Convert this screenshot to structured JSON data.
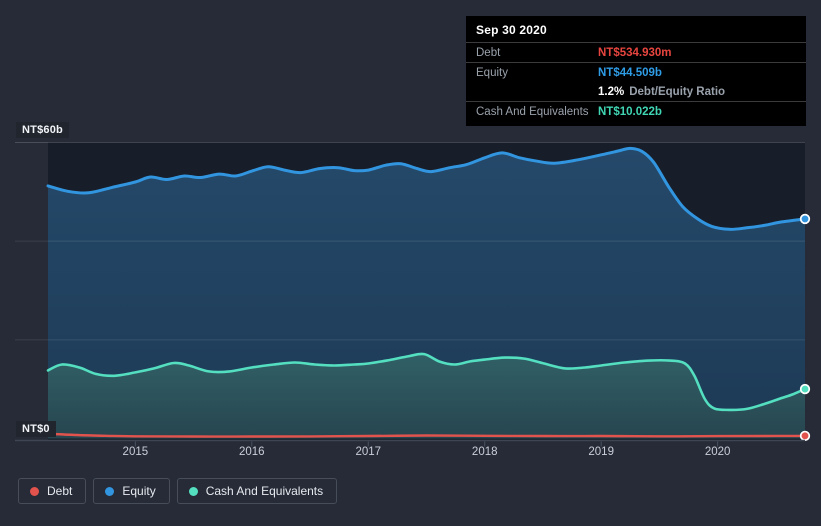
{
  "page": {
    "bg": "#262b37",
    "plot_bg": "#171e29"
  },
  "tooltip": {
    "date": "Sep 30 2020",
    "rows": [
      {
        "label": "Debt",
        "value": "NT$534.930m"
      },
      {
        "label": "Equity",
        "value": "NT$44.509b"
      },
      {
        "label": "",
        "value_bold": "1.2%",
        "value_rest": "Debt/Equity Ratio"
      },
      {
        "label": "Cash And Equivalents",
        "value": "NT$10.022b"
      }
    ]
  },
  "axis": {
    "y_top_label": "NT$60b",
    "y_zero_label": "NT$0",
    "years": [
      "2015",
      "2016",
      "2017",
      "2018",
      "2019",
      "2020"
    ]
  },
  "legend": [
    {
      "label": "Debt"
    },
    {
      "label": "Equity"
    },
    {
      "label": "Cash And Equivalents"
    }
  ],
  "colors": {
    "debt_line": "#e2534d",
    "equity_line": "#3295e0",
    "cash_line": "#54dfc0",
    "debt_text": "#e8453f",
    "equity_text": "#2f9ce6",
    "cash_text": "#40d6b4",
    "equity_fill_top": "#25496a",
    "equity_fill_bottom": "#1d3a55",
    "cash_fill_top": "#316067",
    "cash_fill_bottom": "#27454f",
    "grid": "rgba(255,255,255,0.10)",
    "grid_top": "rgba(255,255,255,0.17)",
    "axis_line": "#3f4552",
    "tick": "#4a5160"
  },
  "chart_data": {
    "type": "area",
    "title": "",
    "unit": "NT$ billions",
    "x_domain": [
      2014.25,
      2020.75
    ],
    "y_domain": [
      0,
      60
    ],
    "y_gridlines_b": [
      20,
      40,
      60
    ],
    "x_ticks": [
      2015,
      2016,
      2017,
      2018,
      2019,
      2020
    ],
    "series": [
      {
        "name": "Equity",
        "points": [
          [
            2014.25,
            51.2
          ],
          [
            2014.42,
            50.1
          ],
          [
            2014.6,
            49.8
          ],
          [
            2014.8,
            50.9
          ],
          [
            2015.0,
            52.0
          ],
          [
            2015.13,
            53.0
          ],
          [
            2015.27,
            52.5
          ],
          [
            2015.42,
            53.2
          ],
          [
            2015.56,
            52.9
          ],
          [
            2015.72,
            53.6
          ],
          [
            2015.86,
            53.2
          ],
          [
            2016.0,
            54.2
          ],
          [
            2016.14,
            55.1
          ],
          [
            2016.28,
            54.4
          ],
          [
            2016.42,
            53.9
          ],
          [
            2016.58,
            54.7
          ],
          [
            2016.74,
            54.9
          ],
          [
            2016.88,
            54.3
          ],
          [
            2017.0,
            54.4
          ],
          [
            2017.15,
            55.4
          ],
          [
            2017.28,
            55.7
          ],
          [
            2017.42,
            54.7
          ],
          [
            2017.54,
            54.1
          ],
          [
            2017.7,
            54.9
          ],
          [
            2017.84,
            55.5
          ],
          [
            2018.0,
            56.9
          ],
          [
            2018.15,
            57.9
          ],
          [
            2018.3,
            56.9
          ],
          [
            2018.45,
            56.2
          ],
          [
            2018.6,
            55.8
          ],
          [
            2018.8,
            56.5
          ],
          [
            2019.0,
            57.5
          ],
          [
            2019.15,
            58.3
          ],
          [
            2019.25,
            58.8
          ],
          [
            2019.35,
            58.2
          ],
          [
            2019.45,
            56.0
          ],
          [
            2019.58,
            51.0
          ],
          [
            2019.7,
            47.0
          ],
          [
            2019.83,
            44.5
          ],
          [
            2019.95,
            43.0
          ],
          [
            2020.1,
            42.4
          ],
          [
            2020.25,
            42.7
          ],
          [
            2020.4,
            43.2
          ],
          [
            2020.55,
            43.9
          ],
          [
            2020.75,
            44.509
          ]
        ]
      },
      {
        "name": "Cash And Equivalents",
        "points": [
          [
            2014.25,
            13.8
          ],
          [
            2014.37,
            15.0
          ],
          [
            2014.52,
            14.4
          ],
          [
            2014.66,
            13.1
          ],
          [
            2014.82,
            12.7
          ],
          [
            2015.0,
            13.4
          ],
          [
            2015.16,
            14.2
          ],
          [
            2015.33,
            15.3
          ],
          [
            2015.46,
            14.8
          ],
          [
            2015.63,
            13.6
          ],
          [
            2015.81,
            13.6
          ],
          [
            2016.0,
            14.4
          ],
          [
            2016.19,
            15.0
          ],
          [
            2016.37,
            15.4
          ],
          [
            2016.54,
            15.0
          ],
          [
            2016.71,
            14.8
          ],
          [
            2016.88,
            15.0
          ],
          [
            2017.0,
            15.2
          ],
          [
            2017.18,
            15.9
          ],
          [
            2017.35,
            16.7
          ],
          [
            2017.48,
            17.1
          ],
          [
            2017.61,
            15.6
          ],
          [
            2017.74,
            15.0
          ],
          [
            2017.87,
            15.6
          ],
          [
            2018.0,
            16.0
          ],
          [
            2018.17,
            16.4
          ],
          [
            2018.34,
            16.2
          ],
          [
            2018.51,
            15.2
          ],
          [
            2018.69,
            14.2
          ],
          [
            2018.86,
            14.4
          ],
          [
            2019.0,
            14.8
          ],
          [
            2019.2,
            15.4
          ],
          [
            2019.41,
            15.8
          ],
          [
            2019.59,
            15.8
          ],
          [
            2019.72,
            15.2
          ],
          [
            2019.8,
            12.7
          ],
          [
            2019.89,
            8.0
          ],
          [
            2019.97,
            6.1
          ],
          [
            2020.1,
            5.8
          ],
          [
            2020.25,
            6.0
          ],
          [
            2020.4,
            7.0
          ],
          [
            2020.55,
            8.2
          ],
          [
            2020.65,
            9.0
          ],
          [
            2020.75,
            10.022
          ]
        ]
      },
      {
        "name": "Debt",
        "points": [
          [
            2014.25,
            0.95
          ],
          [
            2014.5,
            0.7
          ],
          [
            2014.75,
            0.55
          ],
          [
            2015.0,
            0.45
          ],
          [
            2015.5,
            0.4
          ],
          [
            2016.0,
            0.4
          ],
          [
            2016.5,
            0.42
          ],
          [
            2017.0,
            0.5
          ],
          [
            2017.5,
            0.6
          ],
          [
            2018.0,
            0.55
          ],
          [
            2018.5,
            0.5
          ],
          [
            2019.0,
            0.5
          ],
          [
            2019.5,
            0.45
          ],
          [
            2020.0,
            0.48
          ],
          [
            2020.4,
            0.5
          ],
          [
            2020.75,
            0.535
          ]
        ]
      }
    ]
  }
}
